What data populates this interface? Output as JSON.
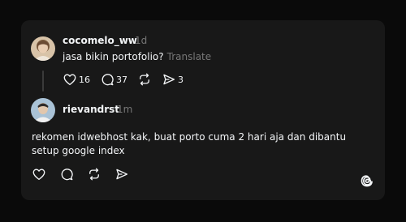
{
  "post": {
    "username": "cocomelo_ww",
    "time": "1d",
    "text": "jasa bikin portofolio?",
    "translate_label": "Translate",
    "likes": "16",
    "comments": "37",
    "shares": "3",
    "avatar_icon": "avatar-photo-icon"
  },
  "reply": {
    "username": "rievandrst",
    "time": "1m",
    "text": "rekomen idwebhost kak, buat porto cuma 2 hari aja dan dibantu setup google index",
    "avatar_icon": "avatar-photo-icon"
  },
  "icons": [
    "heart-icon",
    "comment-icon",
    "repost-icon",
    "send-icon",
    "threads-logo-icon"
  ],
  "colors": {
    "background": "#0a0a0a",
    "card": "#181818",
    "text": "#f3f5f7",
    "muted": "#777777"
  }
}
